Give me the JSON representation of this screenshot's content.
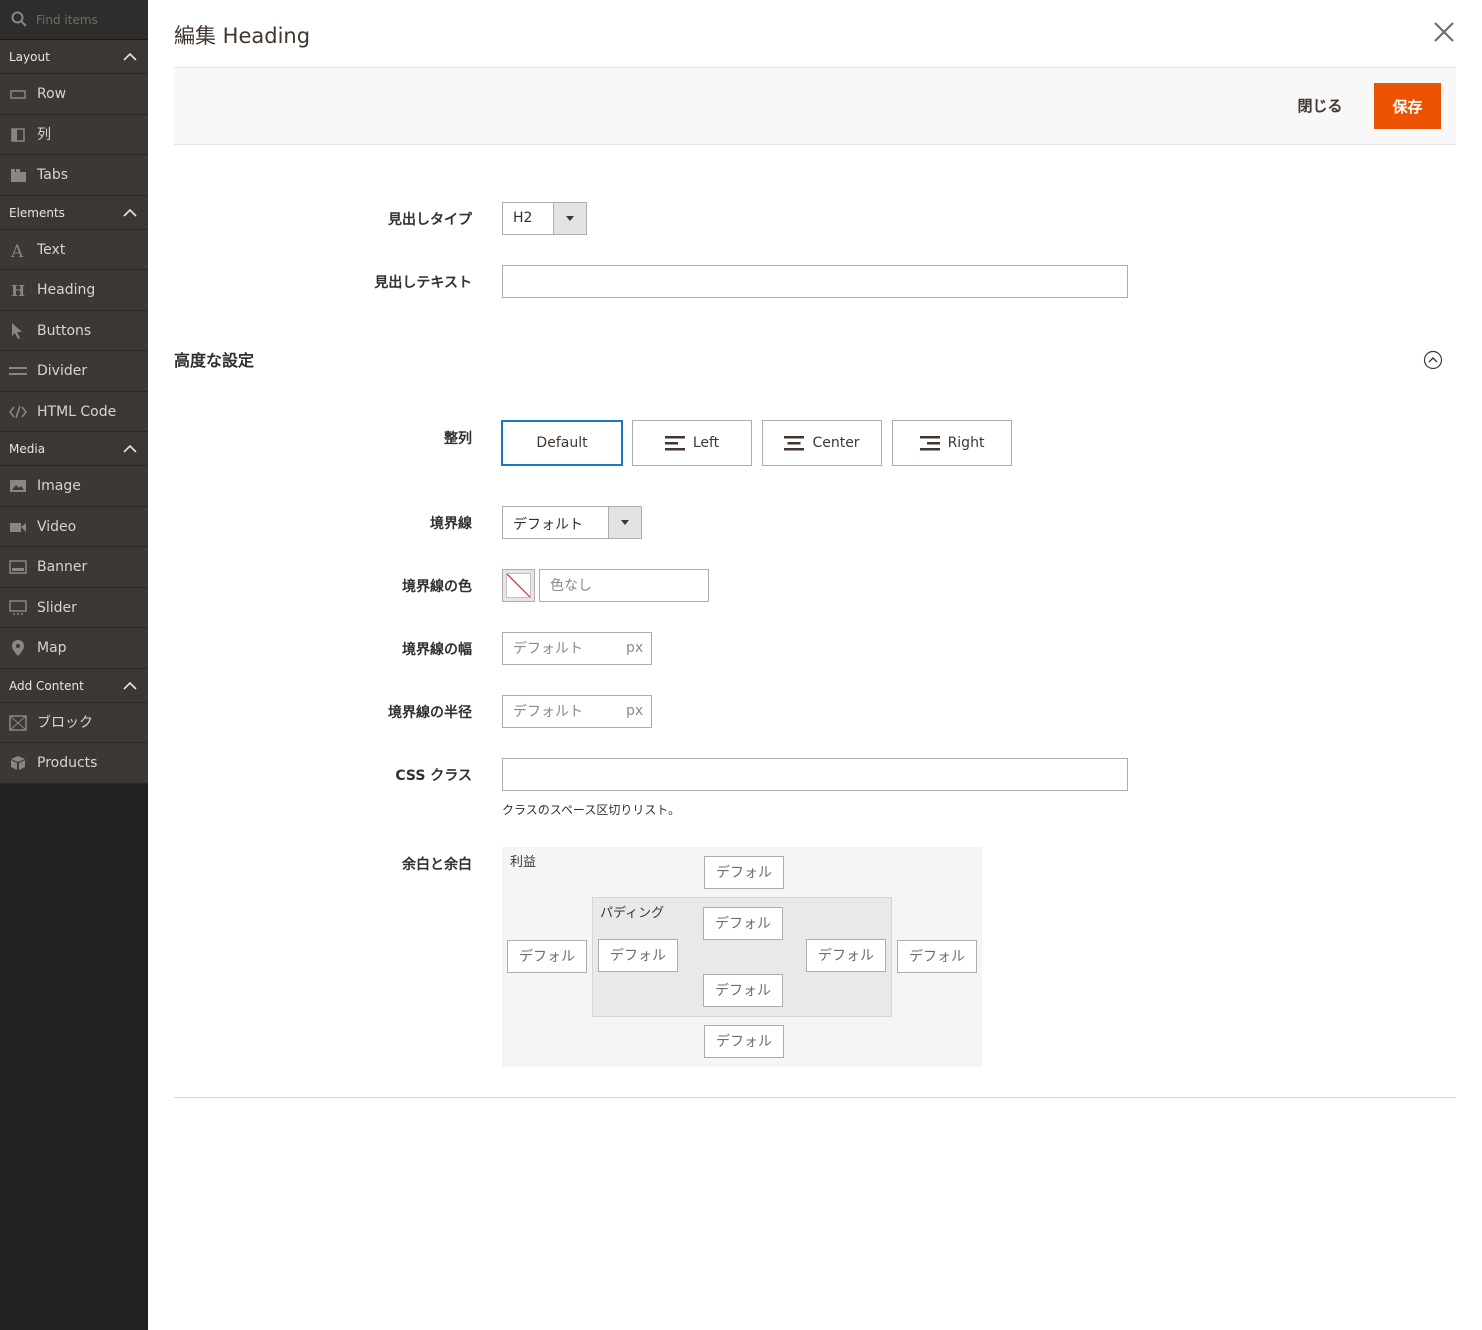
{
  "sidebar": {
    "search_placeholder": "Find items",
    "groups": [
      {
        "title": "Layout",
        "items": [
          {
            "label": "Row",
            "icon": "row-icon"
          },
          {
            "label": "列",
            "icon": "column-icon"
          },
          {
            "label": "Tabs",
            "icon": "tabs-icon"
          }
        ]
      },
      {
        "title": "Elements",
        "items": [
          {
            "label": "Text",
            "icon": "text-icon"
          },
          {
            "label": "Heading",
            "icon": "heading-icon"
          },
          {
            "label": "Buttons",
            "icon": "cursor-icon"
          },
          {
            "label": "Divider",
            "icon": "divider-icon"
          },
          {
            "label": "HTML Code",
            "icon": "code-icon"
          }
        ]
      },
      {
        "title": "Media",
        "items": [
          {
            "label": "Image",
            "icon": "image-icon"
          },
          {
            "label": "Video",
            "icon": "video-icon"
          },
          {
            "label": "Banner",
            "icon": "banner-icon"
          },
          {
            "label": "Slider",
            "icon": "slider-icon"
          },
          {
            "label": "Map",
            "icon": "map-pin-icon"
          }
        ]
      },
      {
        "title": "Add Content",
        "items": [
          {
            "label": "ブロック",
            "icon": "block-icon"
          },
          {
            "label": "Products",
            "icon": "products-icon"
          }
        ]
      }
    ]
  },
  "modal": {
    "title": "編集 Heading",
    "close_label": "閉じる",
    "save_label": "保存"
  },
  "form": {
    "heading_type": {
      "label": "見出しタイプ",
      "value": "H2"
    },
    "heading_text": {
      "label": "見出しテキスト",
      "value": ""
    },
    "advanced_title": "高度な設定",
    "alignment": {
      "label": "整列",
      "options": [
        "Default",
        "Left",
        "Center",
        "Right"
      ],
      "selected": "Default"
    },
    "border": {
      "label": "境界線",
      "value": "デフォルト"
    },
    "border_color": {
      "label": "境界線の色",
      "placeholder": "色なし"
    },
    "border_width": {
      "label": "境界線の幅",
      "placeholder": "デフォルト",
      "unit": "px"
    },
    "border_radius": {
      "label": "境界線の半径",
      "placeholder": "デフォルト",
      "unit": "px"
    },
    "css_class": {
      "label": "CSS クラス",
      "value": "",
      "hint": "クラスのスペース区切りリスト。"
    },
    "spacing": {
      "label": "余白と余白",
      "margin_label": "利益",
      "padding_label": "パディング",
      "placeholder": "デフォル"
    }
  },
  "colors": {
    "accent": "#eb5202",
    "focus": "#1979c3",
    "sidebar_bg": "#242220"
  }
}
